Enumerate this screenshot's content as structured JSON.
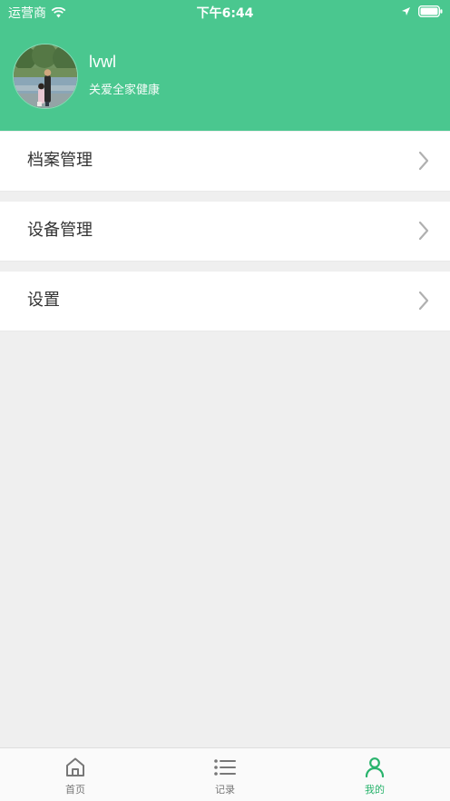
{
  "status_bar": {
    "carrier": "运营商",
    "time": "下午6:44"
  },
  "profile": {
    "username": "lvwl",
    "slogan": "关爱全家健康"
  },
  "menu": {
    "items": [
      {
        "label": "档案管理"
      },
      {
        "label": "设备管理"
      },
      {
        "label": "设置"
      }
    ]
  },
  "bottom_nav": {
    "items": [
      {
        "label": "首页",
        "icon": "home-icon"
      },
      {
        "label": "记录",
        "icon": "list-icon"
      },
      {
        "label": "我的",
        "icon": "user-icon",
        "active": true
      }
    ]
  },
  "colors": {
    "brand": "#4ac78f",
    "active_tab": "#28b36c"
  }
}
